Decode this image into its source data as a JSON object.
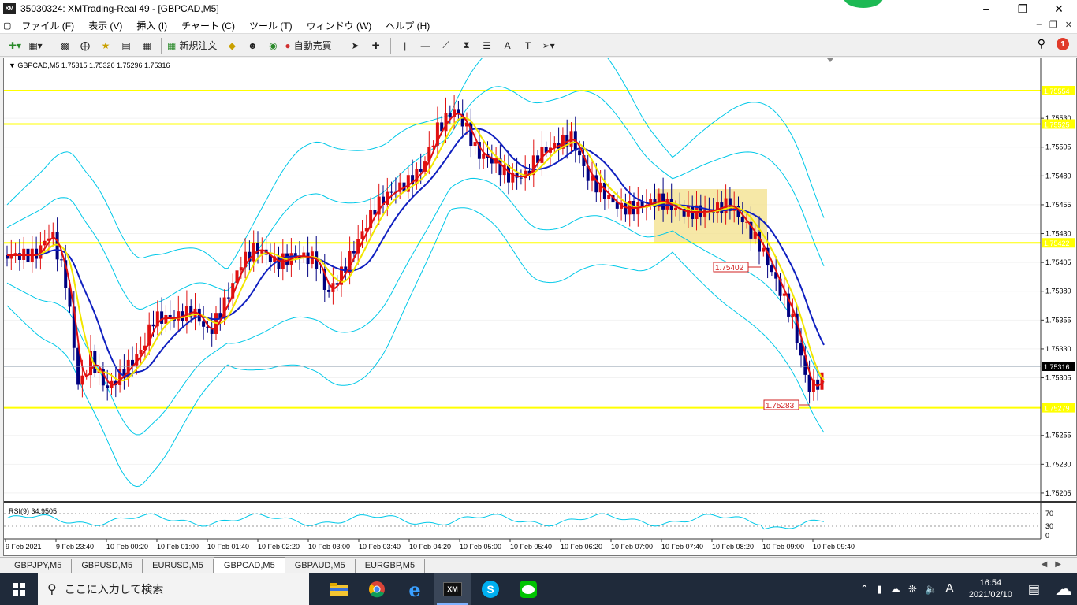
{
  "window": {
    "title": "35030324: XMTrading-Real 49 - [GBPCAD,M5]",
    "app_icon_label": "XM"
  },
  "menu": [
    "ファイル (F)",
    "表示 (V)",
    "挿入 (I)",
    "チャート (C)",
    "ツール (T)",
    "ウィンドウ (W)",
    "ヘルプ (H)"
  ],
  "toolbar": {
    "new_order": "新規注文",
    "auto_trading": "自動売買",
    "text_tool": "A",
    "text_label_tool": "T",
    "notification_count": "1"
  },
  "chart": {
    "symbol_info": "GBPCAD,M5  1.75315 1.75326 1.75296 1.75316",
    "rsi_info": "RSI(9) 34.9505",
    "price_axis": [
      "1.75530",
      "1.75505",
      "1.75480",
      "1.75455",
      "1.75430",
      "1.75405",
      "1.75380",
      "1.75355",
      "1.75330",
      "1.75305",
      "1.75255",
      "1.75230",
      "1.75205"
    ],
    "hline_labels": [
      "1.75554",
      "1.75525",
      "1.75422",
      "1.75279"
    ],
    "current_price": "1.75316",
    "box_labels": [
      "1.75402",
      "1.75283"
    ],
    "rsi_axis": [
      "70",
      "30",
      "0"
    ],
    "time_axis": [
      "9 Feb 2021",
      "9 Feb 23:40",
      "10 Feb 00:20",
      "10 Feb 01:00",
      "10 Feb 01:40",
      "10 Feb 02:20",
      "10 Feb 03:00",
      "10 Feb 03:40",
      "10 Feb 04:20",
      "10 Feb 05:00",
      "10 Feb 05:40",
      "10 Feb 06:20",
      "10 Feb 07:00",
      "10 Feb 07:40",
      "10 Feb 08:20",
      "10 Feb 09:00",
      "10 Feb 09:40"
    ],
    "colors": {
      "bull": "#e01010",
      "bear": "#000080",
      "hline": "#ffff00",
      "bollinger": "#00c8e8",
      "ma_fast": "#e01010",
      "ma_mid": "#f2e600",
      "ma_slow": "#1020c0",
      "highlight": "#f3e08a"
    }
  },
  "tabs": [
    "GBPJPY,M5",
    "GBPUSD,M5",
    "EURUSD,M5",
    "GBPCAD,M5",
    "GBPAUD,M5",
    "EURGBP,M5"
  ],
  "active_tab": "GBPCAD,M5",
  "taskbar": {
    "search_placeholder": "ここに入力して検索",
    "ime": "A",
    "time": "16:54",
    "date": "2021/02/10",
    "apps": [
      "file-explorer",
      "chrome",
      "edge",
      "mt4-xm",
      "skype",
      "line"
    ]
  }
}
